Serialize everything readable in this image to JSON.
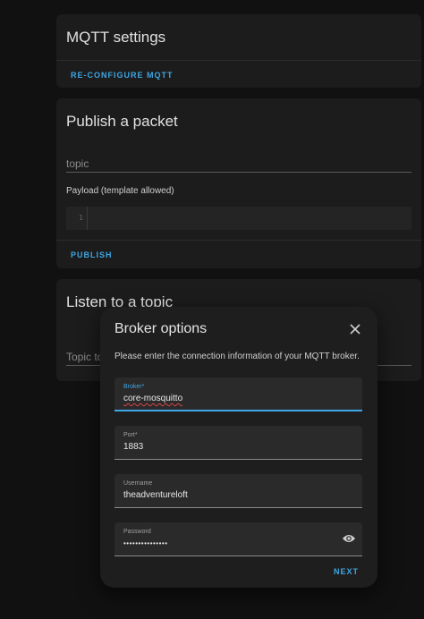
{
  "mqtt_settings": {
    "title": "MQTT settings",
    "reconfigure_label": "RE-CONFIGURE MQTT"
  },
  "publish": {
    "title": "Publish a packet",
    "topic_placeholder": "topic",
    "payload_label": "Payload (template allowed)",
    "line_number": "1",
    "publish_label": "PUBLISH"
  },
  "listen": {
    "title": "Listen to a topic",
    "topic_placeholder": "Topic to subscribe to"
  },
  "dialog": {
    "title": "Broker options",
    "close_icon": "close-icon",
    "description": "Please enter the connection information of your MQTT broker.",
    "fields": {
      "broker": {
        "label": "Broker*",
        "value": "core-mosquitto"
      },
      "port": {
        "label": "Port*",
        "value": "1883"
      },
      "username": {
        "label": "Username",
        "value": "theadventureloft"
      },
      "password": {
        "label": "Password",
        "value": "•••••••••••••••"
      }
    },
    "visibility_icon": "eye-icon",
    "next_label": "NEXT"
  },
  "colors": {
    "accent": "#3ea6e4",
    "background": "#111111",
    "card": "#1c1c1c",
    "dialog": "#1e1e1e"
  }
}
